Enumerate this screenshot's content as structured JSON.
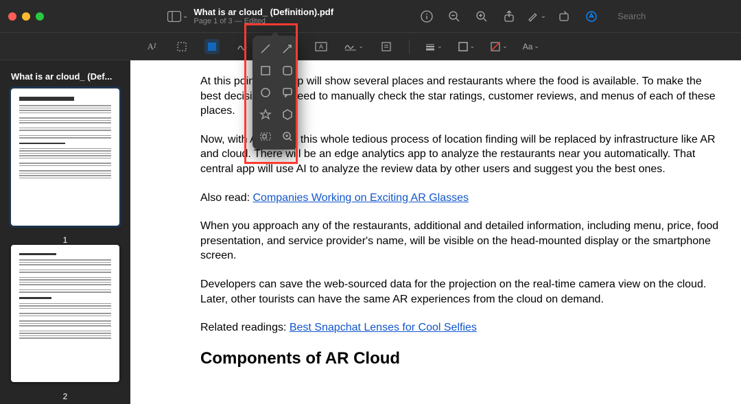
{
  "titlebar": {
    "doc_name": "What is ar cloud_ (Definition).pdf",
    "page_info": "Page 1 of 3  —  Edited",
    "search_placeholder": "Search"
  },
  "sidebar": {
    "title": "What is ar cloud_ (Def...",
    "pages": [
      {
        "num": "1"
      },
      {
        "num": "2"
      }
    ]
  },
  "shapes_popover": {
    "items": [
      "line",
      "arrow",
      "square",
      "rounded-square",
      "circle",
      "speech-bubble",
      "star",
      "hexagon",
      "mask",
      "loupe"
    ]
  },
  "doc": {
    "p1": "At this point, the map will show several places and restaurants where the food is available. To make the best decision, you need to manually check the star ratings, customer reviews, and menus of each of these places.",
    "p2": "Now, with AR cloud, this whole tedious process of location finding will be replaced by infrastructure like AR and cloud. There will be an edge analytics app to analyze the restaurants near you automatically. That central app will use AI to analyze the review data by other users and suggest you the best ones.",
    "p3_prefix": "Also read: ",
    "p3_link": "Companies Working on Exciting AR Glasses",
    "p4": "When you approach any of the restaurants, additional and detailed information, including menu, price, food presentation, and service provider's name, will be visible on the head-mounted display or the smartphone screen.",
    "p5": "Developers can save the web-sourced data for the projection on the real-time camera view on the cloud. Later, other tourists can have the same AR experiences from the cloud on demand.",
    "p6_prefix": "Related readings: ",
    "p6_link": "Best Snapchat Lenses for Cool Selfies",
    "h2": "Components of AR Cloud"
  }
}
